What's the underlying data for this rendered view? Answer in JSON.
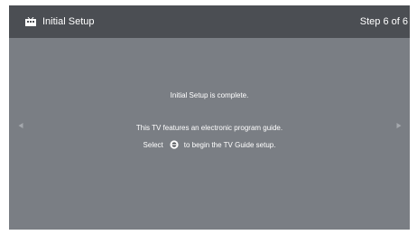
{
  "header": {
    "title": "Initial Setup",
    "step": "Step 6 of 6",
    "icon": "tv-setup-icon"
  },
  "body": {
    "complete_message": "Initial Setup is complete.",
    "guide_message": "This TV features an electronic program guide.",
    "select_prefix": "Select",
    "select_suffix": "to begin the TV Guide setup.",
    "select_icon": "ok-button-icon"
  },
  "navigation": {
    "left_icon": "arrow-left-icon",
    "right_icon": "arrow-right-icon"
  },
  "colors": {
    "header_bg": "#4b4e53",
    "screen_bg": "#7a7e84",
    "text": "#ffffff",
    "arrow": "#a4a8ad"
  }
}
